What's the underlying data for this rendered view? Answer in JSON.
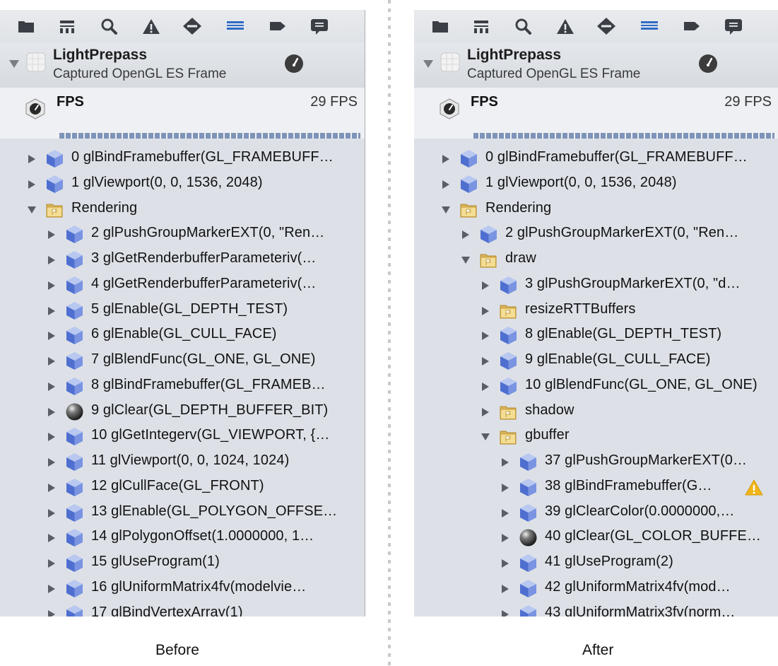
{
  "captions": {
    "before": "Before",
    "after": "After"
  },
  "toolbar_icons": [
    "folder-icon",
    "hierarchy-icon",
    "search-icon",
    "warning-icon",
    "breakpoint-icon",
    "list-icon",
    "tag-icon",
    "comment-icon"
  ],
  "before": {
    "header": {
      "title": "LightPrepass",
      "subtitle": "Captured OpenGL ES Frame"
    },
    "fps": {
      "label": "FPS",
      "value": "29 FPS"
    },
    "rows": [
      {
        "depth": 0,
        "expanded": false,
        "icon": "cube",
        "label": "0 glBindFramebuffer(GL_FRAMEBUFF…"
      },
      {
        "depth": 0,
        "expanded": false,
        "icon": "cube",
        "label": "1 glViewport(0, 0, 1536, 2048)"
      },
      {
        "depth": 0,
        "expanded": true,
        "icon": "folder",
        "label": "Rendering"
      },
      {
        "depth": 1,
        "expanded": false,
        "icon": "cube",
        "label": "2 glPushGroupMarkerEXT(0, \"Ren…"
      },
      {
        "depth": 1,
        "expanded": false,
        "icon": "cube",
        "label": "3 glGetRenderbufferParameteriv(…"
      },
      {
        "depth": 1,
        "expanded": false,
        "icon": "cube",
        "label": "4 glGetRenderbufferParameteriv(…"
      },
      {
        "depth": 1,
        "expanded": false,
        "icon": "cube",
        "label": "5 glEnable(GL_DEPTH_TEST)"
      },
      {
        "depth": 1,
        "expanded": false,
        "icon": "cube",
        "label": "6 glEnable(GL_CULL_FACE)"
      },
      {
        "depth": 1,
        "expanded": false,
        "icon": "cube",
        "label": "7 glBlendFunc(GL_ONE, GL_ONE)"
      },
      {
        "depth": 1,
        "expanded": false,
        "icon": "cube",
        "label": "8 glBindFramebuffer(GL_FRAMEB…"
      },
      {
        "depth": 1,
        "expanded": false,
        "icon": "sphere",
        "label": "9 glClear(GL_DEPTH_BUFFER_BIT)"
      },
      {
        "depth": 1,
        "expanded": false,
        "icon": "cube",
        "label": "10 glGetIntegerv(GL_VIEWPORT, {…"
      },
      {
        "depth": 1,
        "expanded": false,
        "icon": "cube",
        "label": "11 glViewport(0, 0, 1024, 1024)"
      },
      {
        "depth": 1,
        "expanded": false,
        "icon": "cube",
        "label": "12 glCullFace(GL_FRONT)"
      },
      {
        "depth": 1,
        "expanded": false,
        "icon": "cube",
        "label": "13 glEnable(GL_POLYGON_OFFSE…"
      },
      {
        "depth": 1,
        "expanded": false,
        "icon": "cube",
        "label": "14 glPolygonOffset(1.0000000, 1…"
      },
      {
        "depth": 1,
        "expanded": false,
        "icon": "cube",
        "label": "15 glUseProgram(1)"
      },
      {
        "depth": 1,
        "expanded": false,
        "icon": "cube",
        "label": "16 glUniformMatrix4fv(modelvie…"
      },
      {
        "depth": 1,
        "expanded": false,
        "icon": "cube",
        "label": "17 glBindVertexArray(1)"
      }
    ]
  },
  "after": {
    "header": {
      "title": "LightPrepass",
      "subtitle": "Captured OpenGL ES Frame"
    },
    "fps": {
      "label": "FPS",
      "value": "29 FPS"
    },
    "rows": [
      {
        "depth": 0,
        "expanded": false,
        "icon": "cube",
        "label": "0 glBindFramebuffer(GL_FRAMEBUFF…"
      },
      {
        "depth": 0,
        "expanded": false,
        "icon": "cube",
        "label": "1 glViewport(0, 0, 1536, 2048)"
      },
      {
        "depth": 0,
        "expanded": true,
        "icon": "folder",
        "label": "Rendering"
      },
      {
        "depth": 1,
        "expanded": false,
        "icon": "cube",
        "label": "2 glPushGroupMarkerEXT(0, \"Ren…"
      },
      {
        "depth": 1,
        "expanded": true,
        "icon": "folder",
        "label": "draw"
      },
      {
        "depth": 2,
        "expanded": false,
        "icon": "cube",
        "label": "3 glPushGroupMarkerEXT(0, \"d…"
      },
      {
        "depth": 2,
        "expanded": false,
        "icon": "folder",
        "label": "resizeRTTBuffers"
      },
      {
        "depth": 2,
        "expanded": false,
        "icon": "cube",
        "label": "8 glEnable(GL_DEPTH_TEST)"
      },
      {
        "depth": 2,
        "expanded": false,
        "icon": "cube",
        "label": "9 glEnable(GL_CULL_FACE)"
      },
      {
        "depth": 2,
        "expanded": false,
        "icon": "cube",
        "label": "10 glBlendFunc(GL_ONE, GL_ONE)"
      },
      {
        "depth": 2,
        "expanded": false,
        "icon": "folder",
        "label": "shadow"
      },
      {
        "depth": 2,
        "expanded": true,
        "icon": "folder",
        "label": "gbuffer"
      },
      {
        "depth": 3,
        "expanded": false,
        "icon": "cube",
        "label": "37 glPushGroupMarkerEXT(0…"
      },
      {
        "depth": 3,
        "expanded": false,
        "icon": "cube",
        "label": "38 glBindFramebuffer(G…",
        "warning": true
      },
      {
        "depth": 3,
        "expanded": false,
        "icon": "cube",
        "label": "39 glClearColor(0.0000000,…"
      },
      {
        "depth": 3,
        "expanded": false,
        "icon": "sphere",
        "label": "40 glClear(GL_COLOR_BUFFE…"
      },
      {
        "depth": 3,
        "expanded": false,
        "icon": "cube",
        "label": "41 glUseProgram(2)"
      },
      {
        "depth": 3,
        "expanded": false,
        "icon": "cube",
        "label": "42 glUniformMatrix4fv(mod…"
      },
      {
        "depth": 3,
        "expanded": false,
        "icon": "cube",
        "label": "43 glUniformMatrix3fv(norm…"
      }
    ]
  }
}
